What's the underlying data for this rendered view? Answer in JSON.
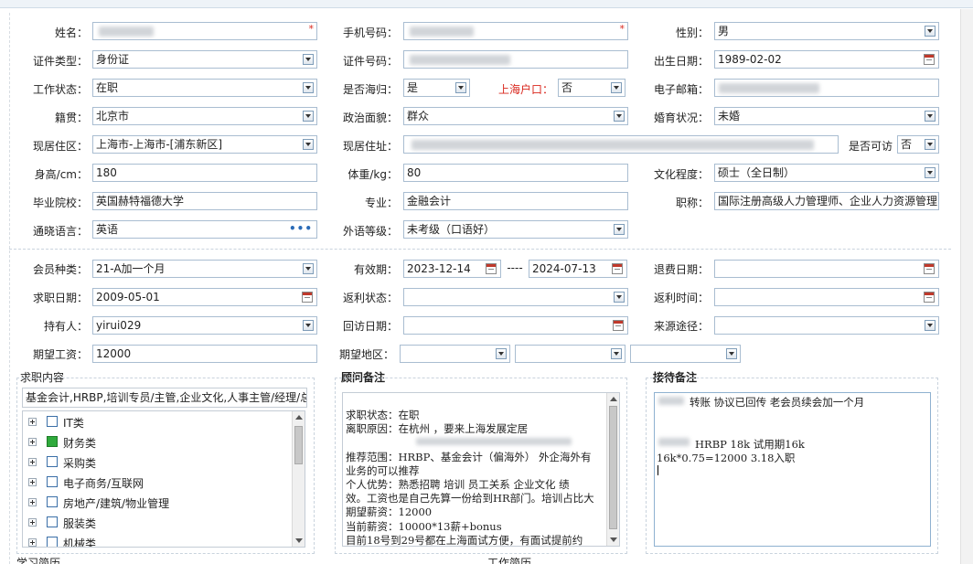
{
  "personal": {
    "name_label": "姓名：",
    "phone_label": "手机号码：",
    "gender_label": "性别：",
    "gender_value": "男",
    "id_type_label": "证件类型：",
    "id_type_value": "身份证",
    "id_no_label": "证件号码：",
    "birth_label": "出生日期：",
    "birth_value": "1989-02-02",
    "work_status_label": "工作状态：",
    "work_status_value": "在职",
    "overseas_label": "是否海归：",
    "overseas_value": "是",
    "sh_hukou_label": "上海户口：",
    "sh_hukou_value": "否",
    "email_label": "电子邮箱：",
    "native_label": "籍贯：",
    "native_value": "北京市",
    "political_label": "政治面貌：",
    "political_value": "群众",
    "marital_label": "婚育状况：",
    "marital_value": "未婚",
    "residence_area_label": "现居住区：",
    "residence_area_value": "上海市-上海市-[浦东新区]",
    "address_label": "现居住址：",
    "visitable_label": "是否可访",
    "visitable_value": "否",
    "height_label": "身高/cm：",
    "height_value": "180",
    "weight_label": "体重/kg：",
    "weight_value": "80",
    "education_label": "文化程度：",
    "education_value": "硕士（全日制）",
    "school_label": "毕业院校：",
    "school_value": "英国赫特福德大学",
    "major_label": "专业：",
    "major_value": "金融会计",
    "title_label": "职称：",
    "title_value": "国际注册高级人力管理师、企业人力资源管理",
    "language_label": "通晓语言：",
    "language_value": "英语",
    "language_level_label": "外语等级：",
    "language_level_value": "未考级（口语好）"
  },
  "membership": {
    "member_type_label": "会员种类：",
    "member_type_value": "21-A加一个月",
    "valid_label": "有效期：",
    "valid_from": "2023-12-14",
    "valid_sep": "----",
    "valid_to": "2024-07-13",
    "refund_label": "退费日期：",
    "job_date_label": "求职日期：",
    "job_date_value": "2009-05-01",
    "rebate_status_label": "返利状态：",
    "rebate_time_label": "返利时间：",
    "holder_label": "持有人：",
    "holder_value": "yirui029",
    "visit_date_label": "回访日期：",
    "source_label": "来源途径：",
    "salary_label": "期望工资：",
    "salary_value": "12000",
    "region_label": "期望地区："
  },
  "job_content": {
    "title": "求职内容",
    "summary": "基金会计,HRBP,培训专员/主管,企业文化,人事主管/经理/总",
    "categories": [
      {
        "label": "IT类",
        "checked": false
      },
      {
        "label": "财务类",
        "checked": true
      },
      {
        "label": "采购类",
        "checked": false
      },
      {
        "label": "电子商务/互联网",
        "checked": false
      },
      {
        "label": "房地产/建筑/物业管理",
        "checked": false
      },
      {
        "label": "服装类",
        "checked": false
      },
      {
        "label": "机械类",
        "checked": false
      }
    ]
  },
  "advisor_notes": {
    "title": "顾问备注",
    "lines": [
      "求职状态：在职",
      "离职原因：在杭州 ，要来上海发展定居",
      "",
      "推荐范围：HRBP、基金会计（偏海外） 外企海外有",
      "业务的可以推荐",
      "个人优势：熟悉招聘 培训 员工关系 企业文化 绩",
      "效。工资也是自己先算一份给到HR部门。培训占比大",
      "期望薪资：12000",
      "当前薪资：10000*13薪+bonus",
      "目前18号到29号都在上海面试方便，有面试提前约"
    ]
  },
  "reception_notes": {
    "title": "接待备注",
    "lines": [
      "转账 协议已回传  老会员续会加一个月",
      "",
      "",
      "HRBP  18k  试用期16k",
      "16k*0.75=12000    3.18入职"
    ]
  },
  "bottom_labels": {
    "left": "学习简历",
    "right": "工作简历"
  },
  "colors": {
    "field_border": "#a9bdd1",
    "accent_red": "#d9261c",
    "checked_green": "#2faa3c"
  }
}
